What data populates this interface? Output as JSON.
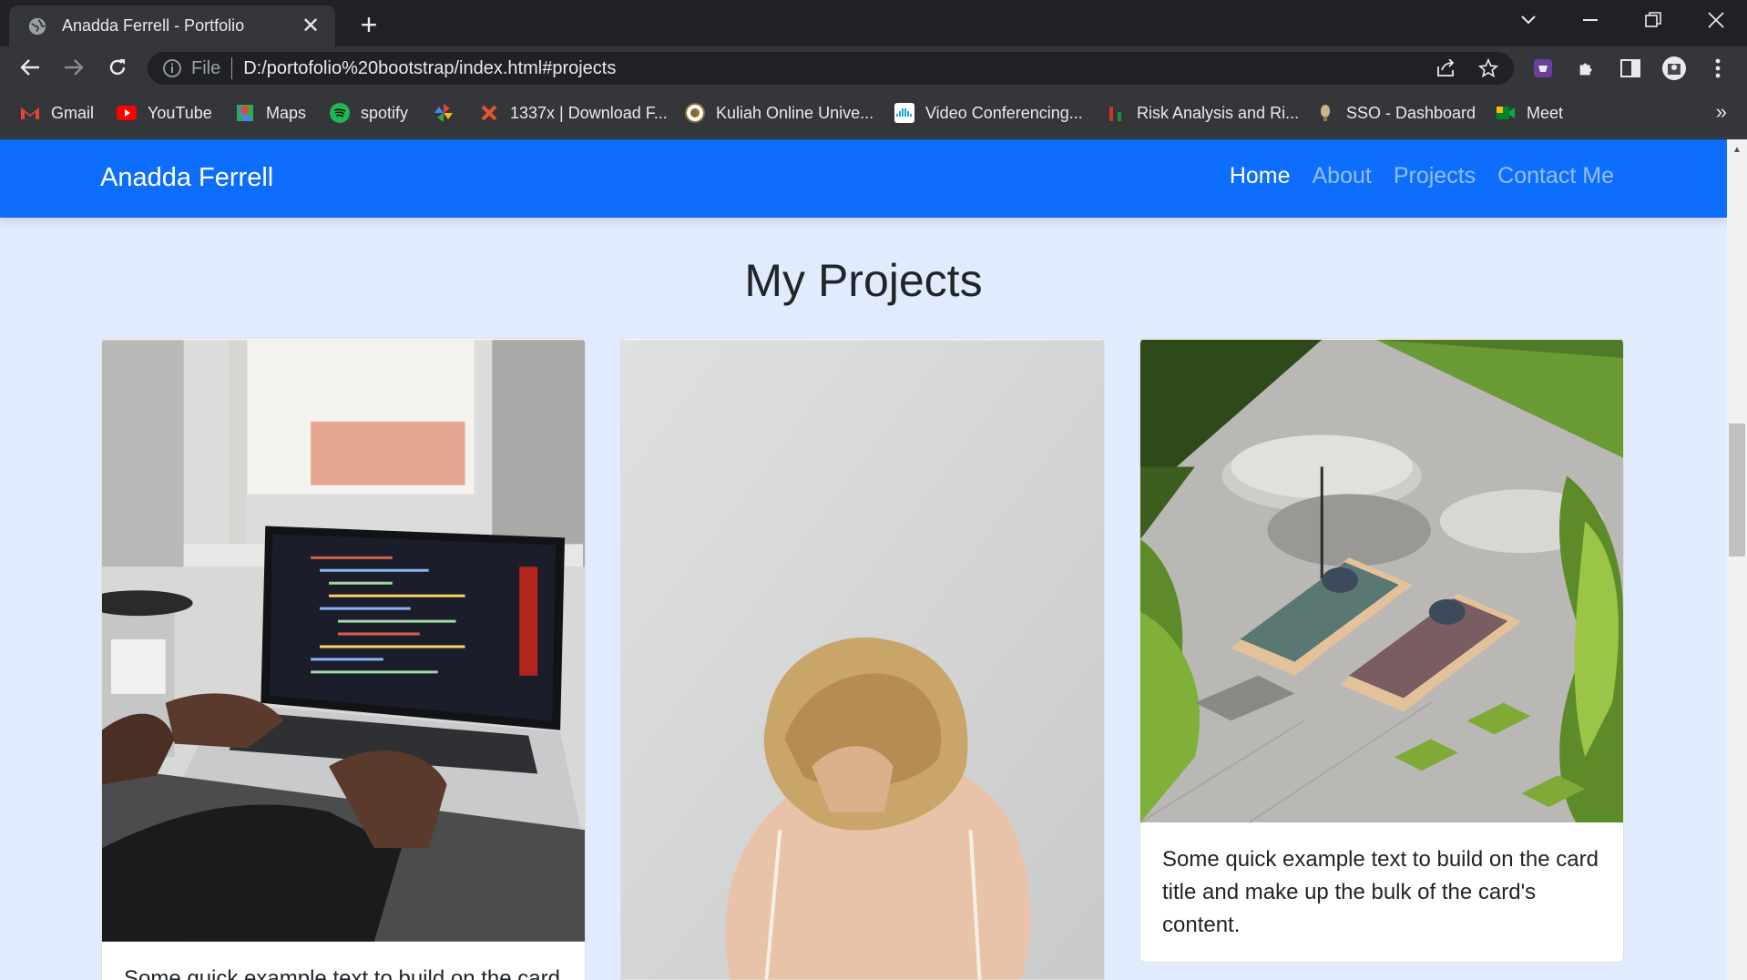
{
  "browser": {
    "tab": {
      "title": "Anadda Ferrell - Portfolio",
      "favicon": "globe-icon"
    },
    "omnibox": {
      "scheme": "File",
      "url": "D:/portofolio%20bootstrap/index.html#projects"
    },
    "bookmarks": [
      {
        "label": "Gmail",
        "icon": "gmail-icon",
        "color": "#ea4335"
      },
      {
        "label": "YouTube",
        "icon": "youtube-icon",
        "color": "#ff0000"
      },
      {
        "label": "Maps",
        "icon": "maps-icon",
        "color": "#34a853"
      },
      {
        "label": "spotify",
        "icon": "spotify-icon",
        "color": "#1db954"
      },
      {
        "label": "",
        "icon": "pinwheel-icon",
        "color": "#fbbc05"
      },
      {
        "label": "1337x | Download F...",
        "icon": "x-icon",
        "color": "#e8552d"
      },
      {
        "label": "Kuliah Online Unive...",
        "icon": "university-icon",
        "color": "#ffffff"
      },
      {
        "label": "Video Conferencing...",
        "icon": "cisco-icon",
        "color": "#049fd9"
      },
      {
        "label": "Risk Analysis and Ri...",
        "icon": "chart-icon",
        "color": "#d93025"
      },
      {
        "label": "SSO - Dashboard",
        "icon": "sso-icon",
        "color": "#c8b68a"
      },
      {
        "label": "Meet",
        "icon": "meet-icon",
        "color": "#00832d"
      }
    ]
  },
  "site": {
    "brand": "Anadda Ferrell",
    "nav": [
      {
        "label": "Home",
        "active": true
      },
      {
        "label": "About",
        "active": false
      },
      {
        "label": "Projects",
        "active": false
      },
      {
        "label": "Contact Me",
        "active": false
      }
    ],
    "section_title": "My Projects",
    "cards": [
      {
        "image": "laptop-code-photo",
        "text": "Some quick example text to build on the card"
      },
      {
        "image": "woman-back-photo",
        "text": ""
      },
      {
        "image": "sun-loungers-photo",
        "text": "Some quick example text to build on the card title and make up the bulk of the card's content."
      }
    ]
  },
  "colors": {
    "navbar": "#0d6efd",
    "page_bg": "#e0ebfd",
    "chrome_dark": "#202124",
    "chrome_toolbar": "#35363a"
  }
}
